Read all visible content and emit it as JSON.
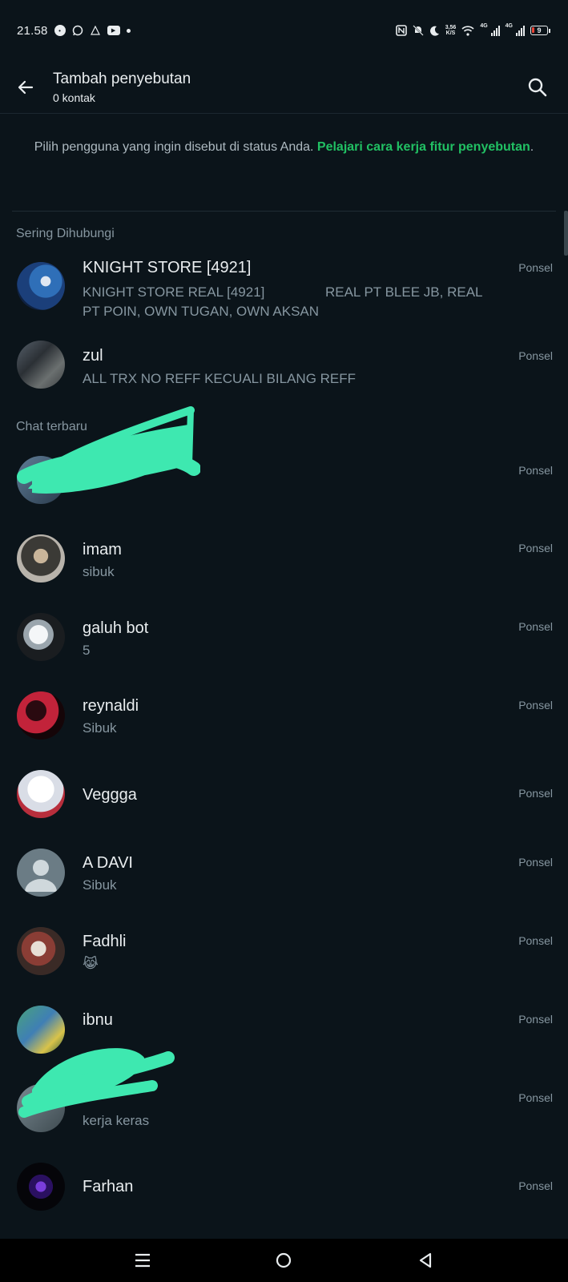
{
  "status_bar": {
    "time": "21.58",
    "speed_top": "3,56",
    "speed_bottom": "K/S",
    "network1": "4G",
    "network2": "4G",
    "battery": "9"
  },
  "header": {
    "title": "Tambah penyebutan",
    "subtitle": "0 kontak"
  },
  "intro": {
    "text": "Pilih pengguna yang ingin disebut di status Anda. ",
    "link": "Pelajari cara kerja fitur penyebutan",
    "suffix": "."
  },
  "sections": {
    "frequent": "Sering Dihubungi",
    "recent": "Chat terbaru"
  },
  "contacts": [
    {
      "name": "KNIGHT STORE [4921]",
      "status_line1": "KNIGHT STORE REAL [4921]                REAL PT BLEE JB, REAL",
      "status_line2": "PT POIN, OWN TUGAN, OWN AKSAN",
      "type": "Ponsel"
    },
    {
      "name": "zul",
      "status": "ALL TRX NO REFF KECUALI BILANG REFF",
      "type": "Ponsel"
    },
    {
      "name": "",
      "status": "",
      "type": "Ponsel"
    },
    {
      "name": "imam",
      "status": "sibuk",
      "type": "Ponsel"
    },
    {
      "name": "galuh bot",
      "status": "5",
      "type": "Ponsel"
    },
    {
      "name": "reynaldi",
      "status": "Sibuk",
      "type": "Ponsel"
    },
    {
      "name": "Veggga",
      "status": "",
      "type": "Ponsel"
    },
    {
      "name": "A DAVI",
      "status": "Sibuk",
      "type": "Ponsel"
    },
    {
      "name": "Fadhli",
      "status": "😹",
      "type": "Ponsel"
    },
    {
      "name": "ibnu",
      "status": "",
      "type": "Ponsel"
    },
    {
      "name": "",
      "status": "kerja keras",
      "type": "Ponsel"
    },
    {
      "name": "Farhan",
      "status": "",
      "type": "Ponsel"
    }
  ],
  "colors": {
    "background": "#0b141a",
    "accent_link": "#21c063",
    "secondary_text": "#8696a0",
    "redaction": "#3ee8b0"
  }
}
